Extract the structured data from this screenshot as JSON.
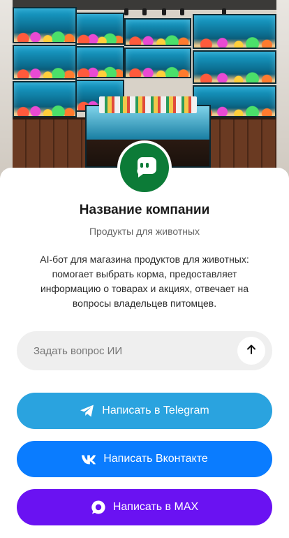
{
  "company": {
    "name": "Название компании",
    "category": "Продукты для животных",
    "description": "AI-бот для магазина продуктов для животных: помогает выбрать корма, предоставляет информацию о товарах и акциях, отвечает на вопросы владельцев питомцев.",
    "avatar_color": "#0c7b37"
  },
  "ask": {
    "placeholder": "Задать вопрос ИИ",
    "send_icon": "arrow-up-icon"
  },
  "buttons": {
    "telegram": {
      "label": "Написать в Telegram",
      "icon": "telegram-icon",
      "color": "#2aa3df"
    },
    "vk": {
      "label": "Написать Вконтакте",
      "icon": "vk-icon",
      "color": "#0a7cff"
    },
    "max": {
      "label": "Написать в MAX",
      "icon": "max-icon",
      "color": "#6a12f2"
    }
  }
}
